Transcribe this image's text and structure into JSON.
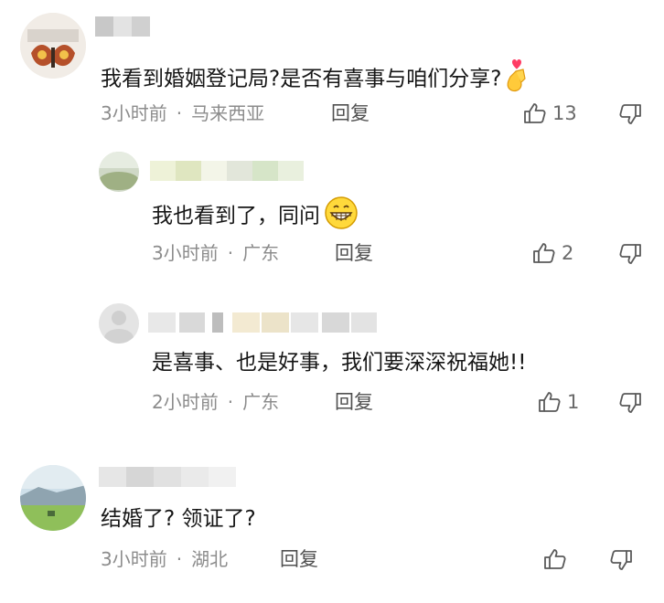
{
  "comments": [
    {
      "text": "我看到婚姻登记局?是否有喜事与咱们分享?",
      "time": "3小时前",
      "location": "马来西亚",
      "reply_label": "回复",
      "likes": "13",
      "emoji": "heart-hand-emoji"
    },
    {
      "text": "我也看到了，同问",
      "time": "3小时前",
      "location": "广东",
      "reply_label": "回复",
      "likes": "2",
      "emoji": "grin-emoji"
    },
    {
      "text": "是喜事、也是好事，我们要深深祝福她!!",
      "time": "2小时前",
      "location": "广东",
      "reply_label": "回复",
      "likes": "1"
    },
    {
      "text": "结婚了? 领证了?",
      "time": "3小时前",
      "location": "湖北",
      "reply_label": "回复",
      "likes": ""
    }
  ],
  "icons": {
    "like": "thumbs-up-icon",
    "dislike": "thumbs-down-icon"
  },
  "colors": {
    "meta_text": "#8c8c8c",
    "body_text": "#161616"
  }
}
